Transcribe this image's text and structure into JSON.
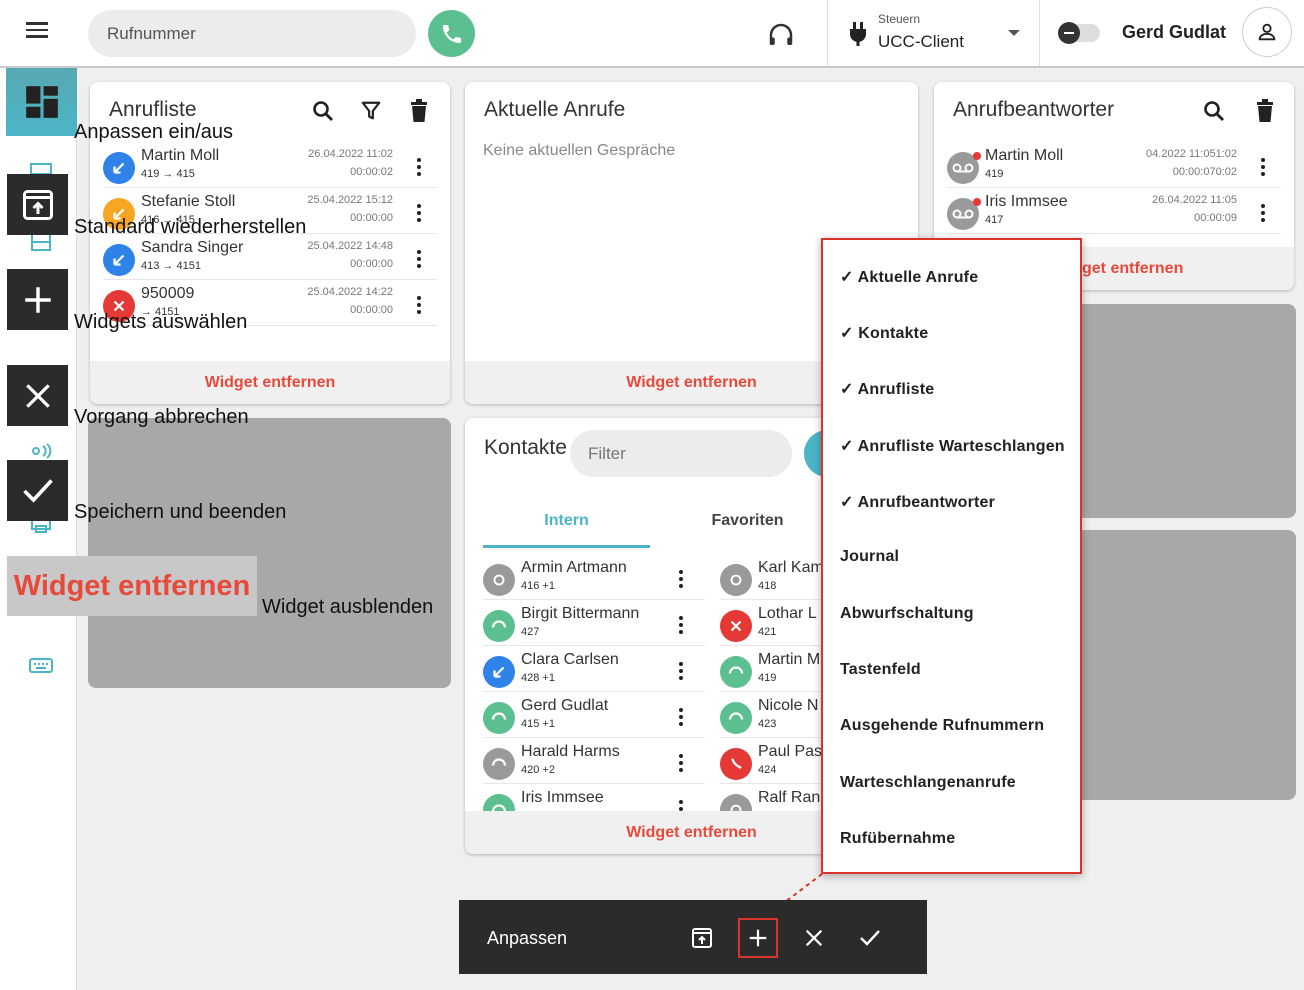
{
  "topbar": {
    "dial_placeholder": "Rufnummer",
    "control_small": "Steuern",
    "control_main": "UCC-Client",
    "username": "Gerd Gudlat"
  },
  "annotations": {
    "toggle_customize": "Anpassen ein/aus",
    "restore_default": "Standard wiederherstellen",
    "select_widgets": "Widgets auswählen",
    "cancel": "Vorgang abbrechen",
    "save_finish": "Speichern und beenden",
    "remove_widget_big": "Widget entfernen",
    "hide_widget": "Widget ausblenden"
  },
  "anrufliste": {
    "title": "Anrufliste",
    "footer": "Widget entfernen",
    "rows": [
      {
        "name": "Martin Moll",
        "sub": "419 → 415",
        "date": "26.04.2022 11:02",
        "dur": "00:00:02"
      },
      {
        "name": "Stefanie Stoll",
        "sub": "416 → 415",
        "date": "25.04.2022 15:12",
        "dur": "00:00:00"
      },
      {
        "name": "Sandra Singer",
        "sub": "413 → 4151",
        "date": "25.04.2022 14:48",
        "dur": "00:00:00"
      },
      {
        "name": "950009",
        "sub": "→ 4151",
        "date": "25.04.2022 14:22",
        "dur": "00:00:00"
      }
    ]
  },
  "aktuelle": {
    "title": "Aktuelle Anrufe",
    "empty": "Keine aktuellen Gespräche",
    "footer": "Widget entfernen"
  },
  "anrufbeantworter": {
    "title": "Anrufbeantworter",
    "footer_partial": "get entfernen",
    "rows": [
      {
        "name": "Martin Moll",
        "sub": "419",
        "date": "04.2022 11:051:02",
        "dur": "00:00:070:02"
      },
      {
        "name": "Iris Immsee",
        "sub": "417",
        "date": "26.04.2022 11:05",
        "dur": "00:00:09"
      }
    ]
  },
  "kontakte": {
    "title": "Kontakte",
    "filter_placeholder": "Filter",
    "tab_intern": "Intern",
    "tab_favoriten": "Favoriten",
    "footer": "Widget entfernen",
    "left": [
      {
        "name": "Armin Artmann",
        "sub": "416 +1"
      },
      {
        "name": "Birgit Bittermann",
        "sub": "427"
      },
      {
        "name": "Clara Carlsen",
        "sub": "428 +1"
      },
      {
        "name": "Gerd Gudlat",
        "sub": "415 +1"
      },
      {
        "name": "Harald Harms",
        "sub": "420 +2"
      },
      {
        "name": "Iris Immsee",
        "sub": ""
      }
    ],
    "right": [
      {
        "name": "Karl Kam",
        "sub": "418"
      },
      {
        "name": "Lothar L",
        "sub": "421"
      },
      {
        "name": "Martin M",
        "sub": "419"
      },
      {
        "name": "Nicole N",
        "sub": "423"
      },
      {
        "name": "Paul Pas",
        "sub": "424"
      },
      {
        "name": "Ralf Ran",
        "sub": ""
      }
    ]
  },
  "dropdown": {
    "items": [
      "✓ Aktuelle Anrufe",
      "✓ Kontakte",
      "✓ Anrufliste",
      "✓ Anrufliste Warteschlangen",
      "✓ Anrufbeantworter",
      "Journal",
      "Abwurfschaltung",
      "Tastenfeld",
      "Ausgehende Rufnummern",
      "Warteschlangenanrufe",
      "Rufübernahme"
    ]
  },
  "custombar": {
    "label": "Anpassen"
  },
  "colors": {
    "accent": "#4bb5c7",
    "danger": "#e74a3b",
    "call_green": "#5cbf8f"
  }
}
